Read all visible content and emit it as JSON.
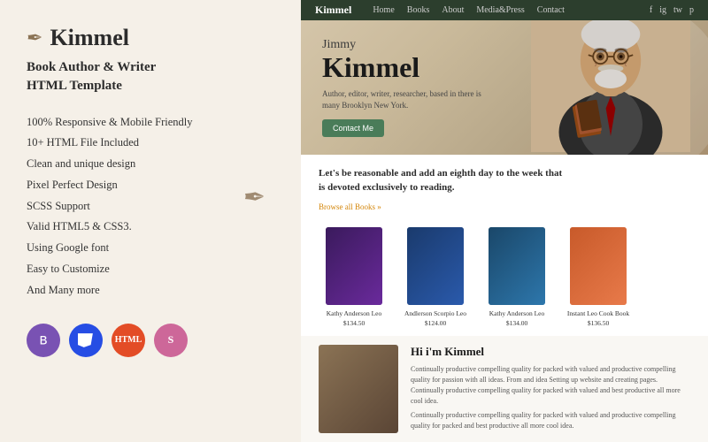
{
  "left": {
    "logo": {
      "icon": "✒",
      "text": "Kimmel"
    },
    "tagline": "Book Author & Writer\nHTML Template",
    "features": [
      "100% Responsive & Mobile Friendly",
      "10+ HTML File Included",
      "Clean and unique design",
      "Pixel Perfect Design",
      "SCSS Support",
      "Valid HTML5 & CSS3.",
      "Using Google font",
      "Easy to Customize",
      "And Many more"
    ],
    "badges": [
      {
        "label": "B",
        "title": "Bootstrap",
        "class": "badge-bootstrap"
      },
      {
        "label": "CSS",
        "title": "CSS3",
        "class": "badge-css"
      },
      {
        "label": "HTML",
        "title": "HTML5",
        "class": "badge-html"
      },
      {
        "label": "S",
        "title": "Sass",
        "class": "badge-sass"
      }
    ]
  },
  "navbar": {
    "brand": "Kimmel",
    "links": [
      "Home",
      "Books",
      "About",
      "Media & Press",
      "Contact"
    ],
    "social": [
      "f",
      "ig",
      "tw",
      "p"
    ]
  },
  "hero": {
    "name_small": "Jimmy",
    "name_large": "Kimmel",
    "subtitle": "Author, editor, writer, researcher, based in there is many Brooklyn New York.",
    "cta_label": "Contact Me"
  },
  "books": {
    "quote": "Let's be reasonable and add an eighth\nday to the week that is devoted\nexclusively to reading.",
    "browse_link": "Browse all Books »",
    "items": [
      {
        "title": "Kathy Anderson Leo",
        "price": "$134.50",
        "cover_class": "book-cover-1"
      },
      {
        "title": "Andlerson Scorpio Leo",
        "price": "$124.00",
        "cover_class": "book-cover-2"
      },
      {
        "title": "Kathy Anderson Leo",
        "price": "$134.00",
        "cover_class": "book-cover-3"
      },
      {
        "title": "Instant Leo Cook Book",
        "price": "$136.50",
        "cover_class": "book-cover-4"
      }
    ]
  },
  "about": {
    "title": "Hi i'm Kimmel",
    "body1": "Continually productive compelling quality for packed with valued and productive compelling quality for passion with all ideas. From and idea Setting up website and creating pages. Continually productive compelling quality for packed with valued and best productive all more cool idea.",
    "body2": "Continually productive compelling quality for packed with valued and productive compelling quality for packed and best productive all more cool idea."
  }
}
